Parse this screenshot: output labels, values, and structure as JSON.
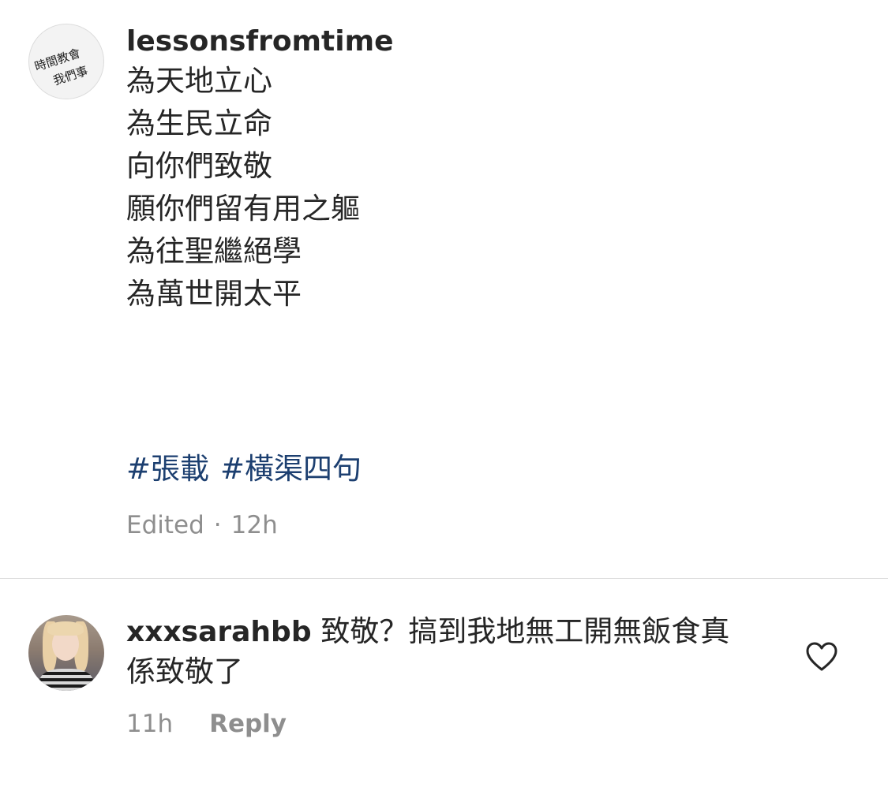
{
  "post": {
    "author": "lessonsfromtime",
    "avatar_logo_text": [
      "時間教會",
      "我們事"
    ],
    "caption_lines": [
      "為天地立心",
      "為生民立命",
      "向你們致敬",
      "願你們留有用之軀",
      "為往聖繼絕學",
      "為萬世開太平"
    ],
    "hashtags": [
      "#張載",
      "#橫渠四句"
    ],
    "edited_label": "Edited",
    "separator": "·",
    "time": "12h"
  },
  "comment": {
    "author": "xxxsarahbb",
    "text": "致敬？搞到我地無工開無飯食真係致敬了",
    "time": "11h",
    "reply_label": "Reply",
    "like_icon": "heart-outline-icon"
  },
  "colors": {
    "text": "#262626",
    "muted": "#8e8e8e",
    "hashtag": "#1c3f70",
    "divider": "#dbdbdb"
  }
}
